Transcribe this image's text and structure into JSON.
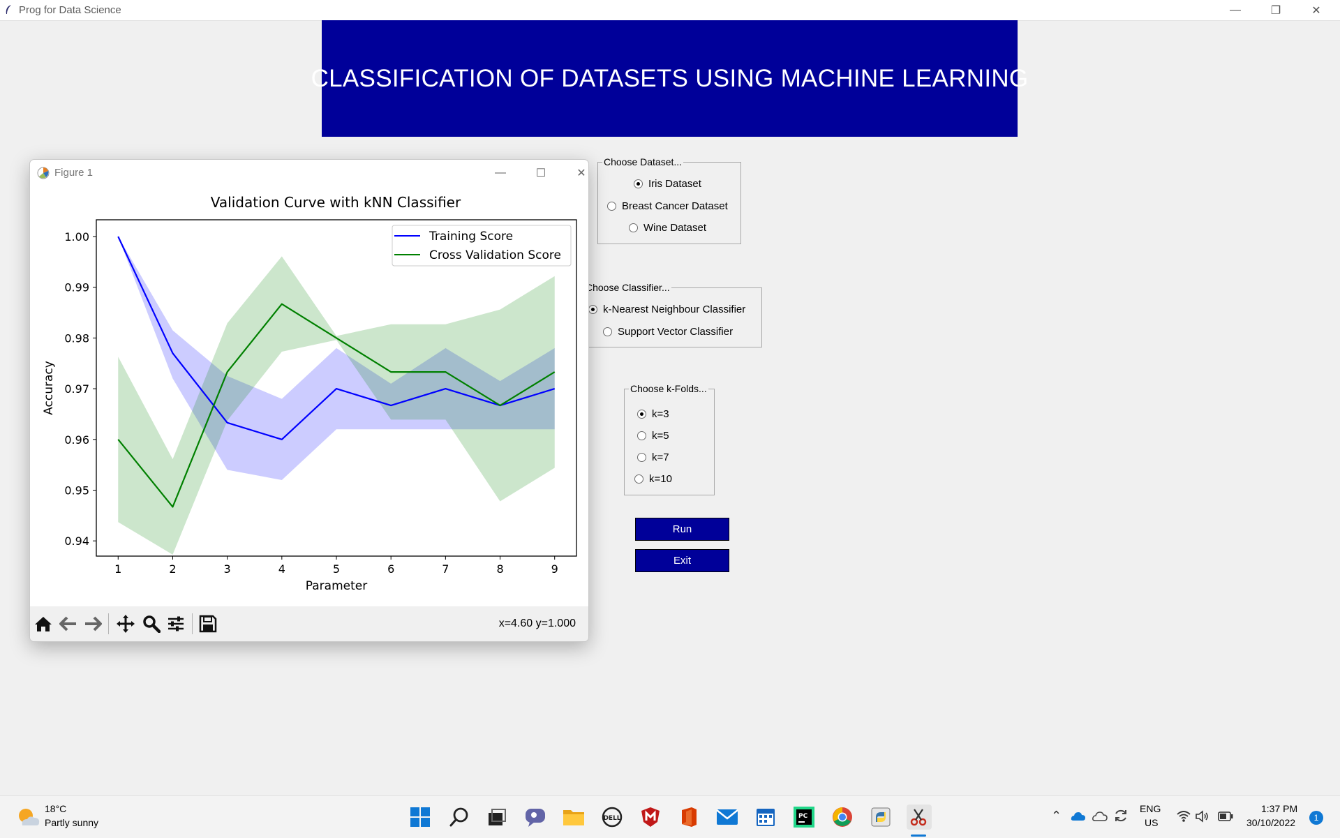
{
  "window": {
    "title": "Prog for Data Science",
    "minimize": "—",
    "restore": "❐",
    "close": "✕"
  },
  "banner": {
    "text": "CLASSIFICATION OF DATASETS USING MACHINE LEARNING"
  },
  "dataset": {
    "legend": "Choose Dataset...",
    "options": [
      {
        "label": "Iris Dataset",
        "selected": true
      },
      {
        "label": "Breast Cancer Dataset",
        "selected": false
      },
      {
        "label": "Wine Dataset",
        "selected": false
      }
    ]
  },
  "classifier": {
    "legend": "Choose Classifier...",
    "options": [
      {
        "label": "k-Nearest Neighbour Classifier",
        "selected": true
      },
      {
        "label": "Support Vector Classifier",
        "selected": false
      }
    ]
  },
  "kfolds": {
    "legend": "Choose k-Folds...",
    "options": [
      {
        "label": "k=3",
        "selected": true
      },
      {
        "label": "k=5",
        "selected": false
      },
      {
        "label": "k=7",
        "selected": false
      },
      {
        "label": "k=10",
        "selected": false
      }
    ]
  },
  "buttons": {
    "run": "Run",
    "exit": "Exit"
  },
  "figure": {
    "title": "Figure 1",
    "minimize": "—",
    "maximize": "☐",
    "close": "✕",
    "coords": "x=4.60 y=1.000"
  },
  "chart_data": {
    "type": "line",
    "title": "Validation Curve with kNN Classifier",
    "xlabel": "Parameter",
    "ylabel": "Accuracy",
    "x": [
      1,
      2,
      3,
      4,
      5,
      6,
      7,
      8,
      9
    ],
    "xlim": [
      0.6,
      9.4
    ],
    "ylim": [
      0.937,
      1.0033
    ],
    "xticks": [
      "1",
      "2",
      "3",
      "4",
      "5",
      "6",
      "7",
      "8",
      "9"
    ],
    "yticks": [
      "0.94",
      "0.95",
      "0.96",
      "0.97",
      "0.98",
      "0.99",
      "1.00"
    ],
    "ytick_values": [
      0.94,
      0.95,
      0.96,
      0.97,
      0.98,
      0.99,
      1.0
    ],
    "legend_position": "top-right",
    "series": [
      {
        "name": "Training Score",
        "color": "#0000ff",
        "values": [
          1.0,
          0.977,
          0.9633,
          0.96,
          0.97,
          0.9667,
          0.97,
          0.9667,
          0.97
        ],
        "band_lower": [
          1.0,
          0.972,
          0.954,
          0.952,
          0.962,
          0.962,
          0.962,
          0.962,
          0.962
        ],
        "band_upper": [
          1.0,
          0.9815,
          0.9725,
          0.968,
          0.978,
          0.971,
          0.978,
          0.9715,
          0.978
        ]
      },
      {
        "name": "Cross Validation Score",
        "color": "#008000",
        "values": [
          0.96,
          0.9467,
          0.9733,
          0.9867,
          0.98,
          0.9733,
          0.9733,
          0.9667,
          0.9733
        ],
        "band_lower": [
          0.9437,
          0.9373,
          0.9637,
          0.9773,
          0.9796,
          0.9639,
          0.9639,
          0.9478,
          0.9544
        ],
        "band_upper": [
          0.9763,
          0.9561,
          0.9829,
          0.9961,
          0.9804,
          0.9827,
          0.9827,
          0.9856,
          0.9922
        ]
      }
    ]
  },
  "taskbar": {
    "weather": {
      "temp": "18°C",
      "desc": "Partly sunny"
    },
    "lang": "ENG",
    "region": "US",
    "time": "1:37 PM",
    "date": "30/10/2022",
    "notifications": "1",
    "icons": [
      "windows-icon",
      "search-icon",
      "task-view-icon",
      "chat-icon",
      "file-explorer-icon",
      "dell-icon",
      "mcafee-icon",
      "office-icon",
      "mail-icon",
      "calendar-icon",
      "pycharm-icon",
      "chrome-icon",
      "python-icon",
      "snipping-tool-icon"
    ]
  }
}
